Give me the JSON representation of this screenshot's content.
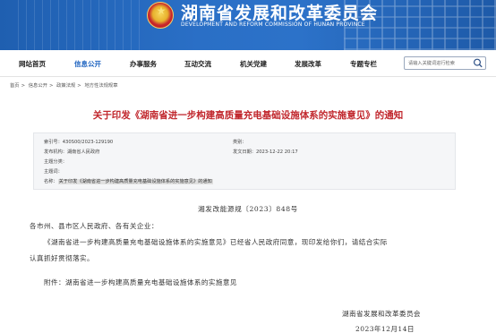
{
  "header": {
    "title": "湖南省发展和改革委员会",
    "subtitle": "DEVELOPMENT AND REFORM COMMISSION OF HUNAN PROVINCE",
    "colors": {
      "banner": "#2a6fc6",
      "accent_red": "#c1272d",
      "nav_active": "#1f64c0"
    }
  },
  "nav": {
    "items": [
      {
        "label": "网站首页"
      },
      {
        "label": "信息公开"
      },
      {
        "label": "办事服务"
      },
      {
        "label": "互动交流"
      },
      {
        "label": "机关党建"
      },
      {
        "label": "发展改革"
      },
      {
        "label": "专题专栏"
      }
    ],
    "active_index": 1,
    "search": {
      "placeholder": "请输入关键词进行检索",
      "icon": "search-icon"
    }
  },
  "breadcrumb": {
    "items": [
      "首页",
      "信息公开",
      "政策法规",
      "地方性法规规章"
    ],
    "separator": ">"
  },
  "article": {
    "title": "关于印发《湖南省进一步构建高质量充电基础设施体系的实施意见》的通知",
    "meta": {
      "index_no": "索引号：430S00/2023-129190",
      "category": "类别：",
      "publisher": "发布机构：湖南省人民政府",
      "publish_date": "发文日期：2023-12-22 20:17",
      "subject_category": "主题分类：",
      "subject_words": "主题词：",
      "name_label": "名称：",
      "name_value": "关于印发《湖南省进一步构建高质量充电基础设施体系的实施意见》的通知"
    },
    "doc_number": "湘发改能源规〔2023〕848号",
    "salutation": "各市州、县市区人民政府、各有关企业：",
    "paragraph_line1": "《湖南省进一步构建高质量充电基础设施体系的实施意见》已经省人民政府同意，现印发给你们，请结合实际",
    "paragraph_line2": "认真抓好贯彻落实。",
    "attachment": "附件：湖南省进一步构建高质量充电基础设施体系的实施意见",
    "signature": "湖南省发展和改革委员会",
    "date": "2023年12月14日"
  }
}
